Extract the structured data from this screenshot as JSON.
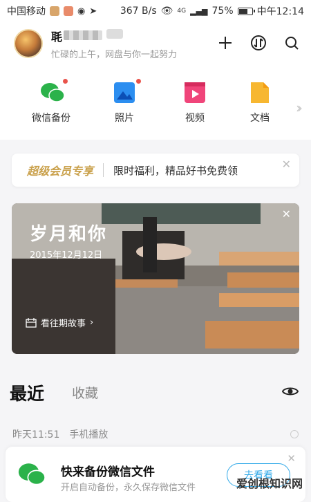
{
  "status_bar": {
    "carrier": "中国移动",
    "speed": "367 B/s",
    "network": "4G",
    "battery_percent": "75%",
    "battery_level": 0.75,
    "time": "中午12:14"
  },
  "header": {
    "username_visible": "毦",
    "subtitle": "忙碌的上午，网盘与你一起努力",
    "icons": [
      "plus-icon",
      "transfer-icon",
      "search-icon"
    ]
  },
  "quick_nav": [
    {
      "label": "微信备份",
      "icon": "wechat-icon",
      "dot": true
    },
    {
      "label": "照片",
      "icon": "photo-icon",
      "dot": true
    },
    {
      "label": "视频",
      "icon": "video-icon",
      "dot": false
    },
    {
      "label": "文档",
      "icon": "document-icon",
      "dot": false
    }
  ],
  "vip_banner": {
    "title": "超级会员专享",
    "text": "限时福利，精品好书免费领"
  },
  "story": {
    "title": "岁月和你",
    "date": "2015年12月12日",
    "link": "看往期故事"
  },
  "tabs": {
    "active": "最近",
    "other": "收藏"
  },
  "recent": {
    "time": "昨天11:51",
    "source": "手机播放"
  },
  "backup_card": {
    "title": "快来备份微信文件",
    "subtitle": "开启自动备份，永久保存微信文件",
    "button": "去看看"
  },
  "watermark": "爱创根知识网",
  "colors": {
    "accent_blue": "#2fa8e8",
    "vip_gold": "#c9a04a",
    "wechat_green": "#2bb24a",
    "red_dot": "#e9534b"
  }
}
